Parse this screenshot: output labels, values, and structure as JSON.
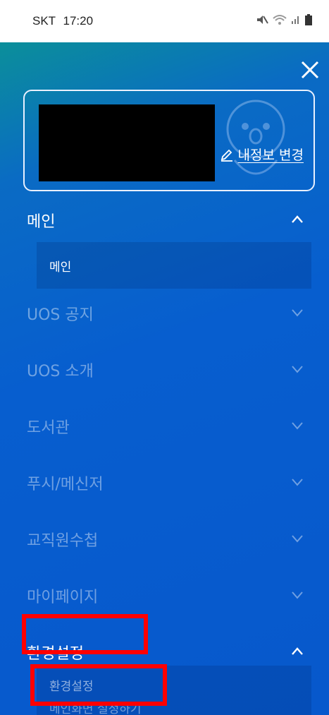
{
  "status_bar": {
    "carrier": "SKT",
    "time": "17:20",
    "icons": [
      "mute-icon",
      "wifi-icon",
      "signal-icon",
      "battery-icon"
    ]
  },
  "drawer": {
    "close_icon": "close-icon",
    "profile": {
      "edit_label": "내정보 변경",
      "edit_icon": "pencil-icon"
    },
    "menus": [
      {
        "label": "메인",
        "expanded": true,
        "items": [
          {
            "label": "메인"
          }
        ]
      },
      {
        "label": "UOS 공지",
        "expanded": false
      },
      {
        "label": "UOS 소개",
        "expanded": false
      },
      {
        "label": "도서관",
        "expanded": false
      },
      {
        "label": "푸시/메신저",
        "expanded": false
      },
      {
        "label": "교직원수첩",
        "expanded": false
      },
      {
        "label": "마이페이지",
        "expanded": false
      },
      {
        "label": "환경설정",
        "expanded": true,
        "items": [
          {
            "label": "환경설정"
          },
          {
            "label": "메인화면 설정하기"
          }
        ]
      }
    ]
  },
  "colors": {
    "drawer_top": "#0b8f9a",
    "drawer_main": "#0758cc",
    "annotation_red": "#ff0000"
  }
}
